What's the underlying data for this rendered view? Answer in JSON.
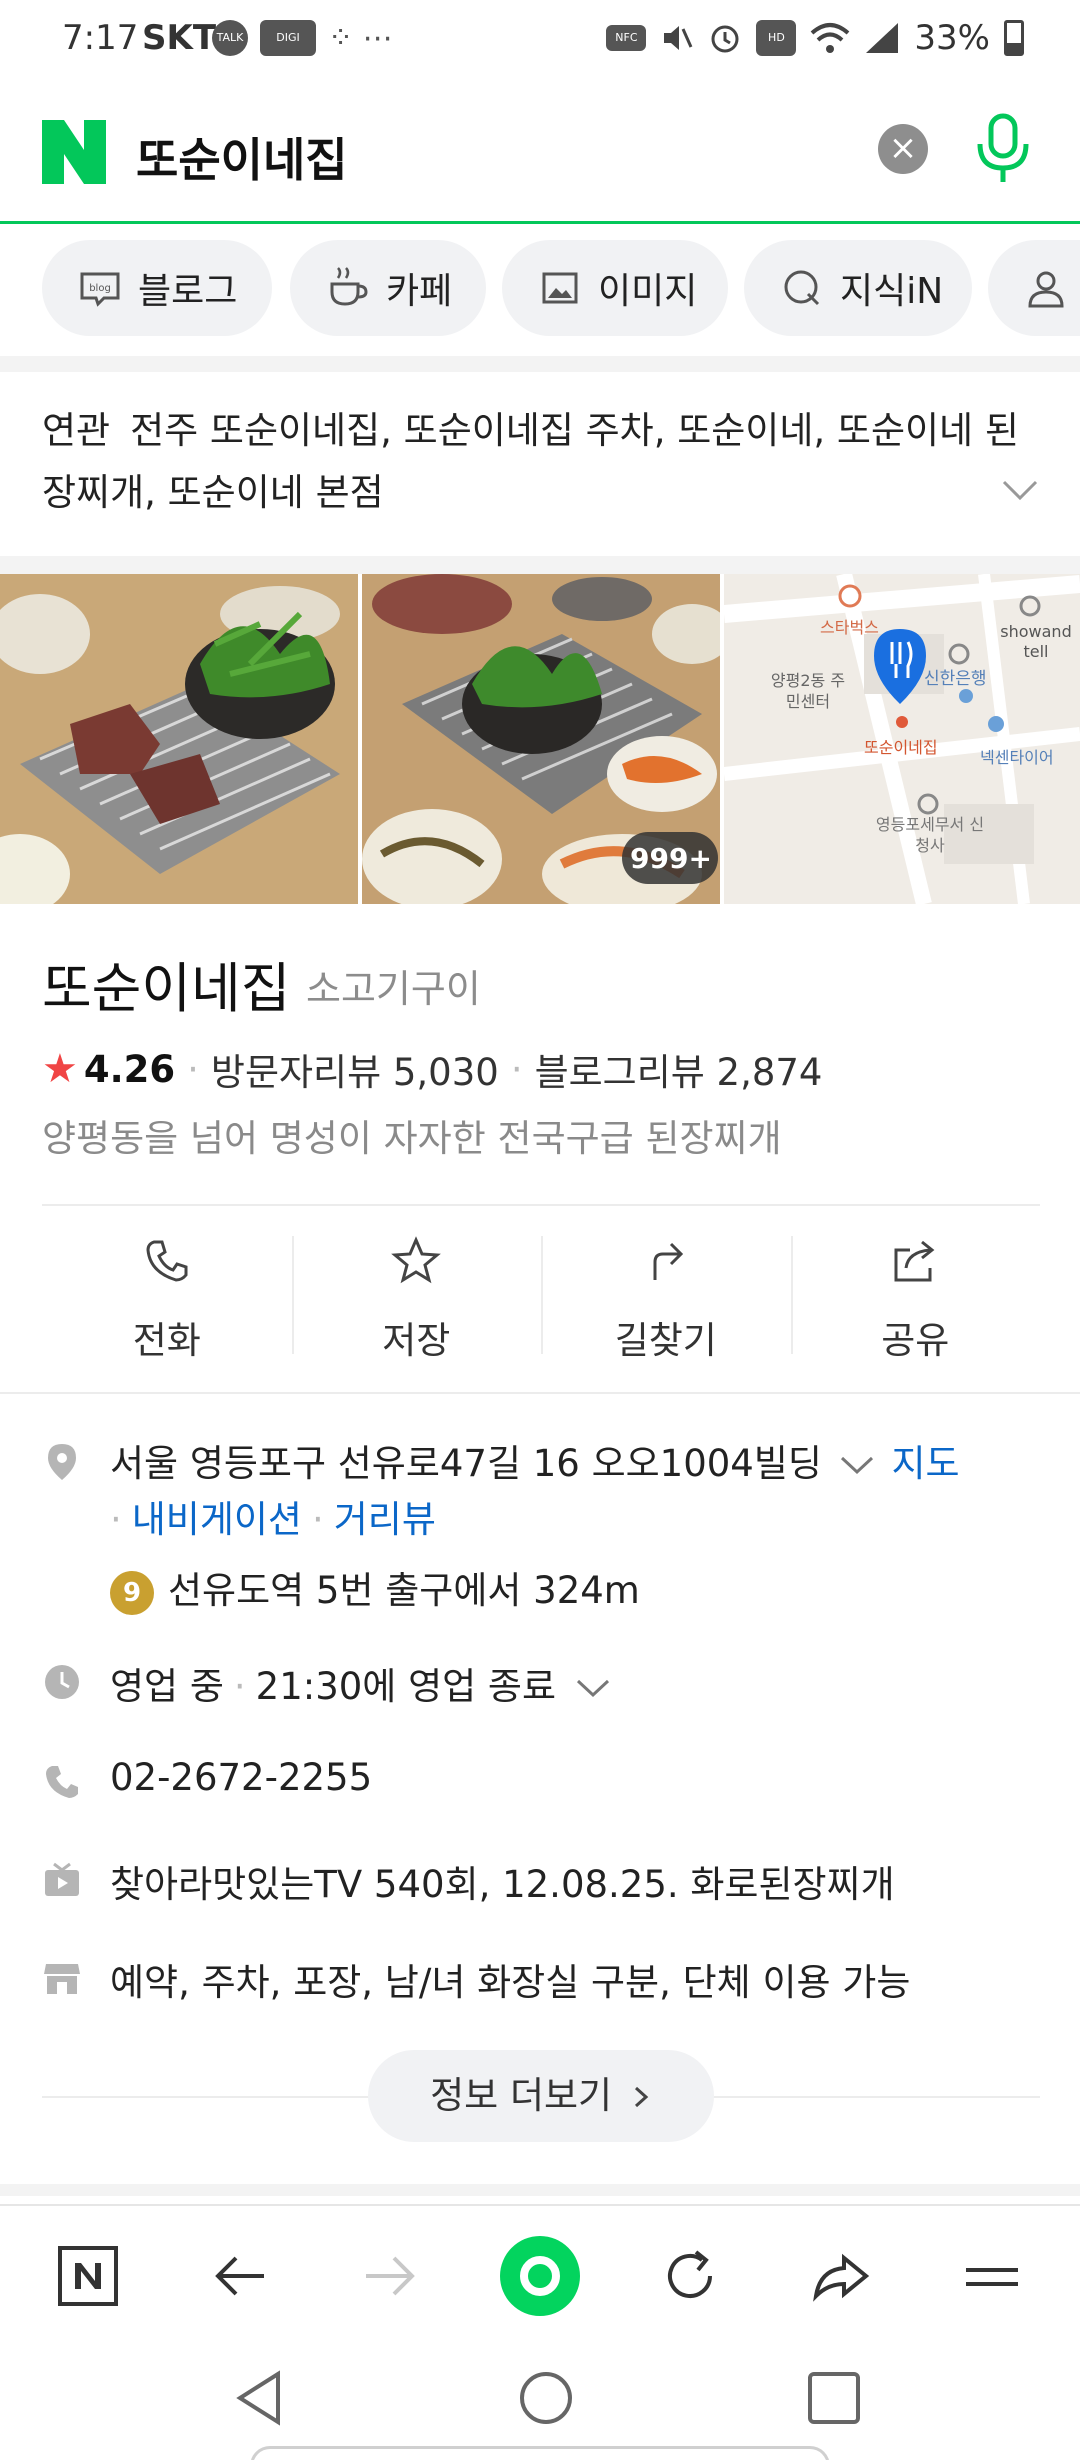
{
  "status_bar": {
    "time": "7:17",
    "carrier": "SKT",
    "battery": "33%",
    "battery_level": 0.33,
    "icons": [
      "talk-icon",
      "digi-loca-icon",
      "nfc-icon",
      "mute-icon",
      "alarm-icon",
      "hd-voice-icon",
      "wifi-icon",
      "signal-icon"
    ]
  },
  "search": {
    "query": "또순이네집",
    "brand_color": "#03c75a"
  },
  "chips": [
    {
      "label": "블로그",
      "icon": "blog-icon"
    },
    {
      "label": "카페",
      "icon": "cafe-cup-icon"
    },
    {
      "label": "이미지",
      "icon": "image-icon"
    },
    {
      "label": "지식iN",
      "icon": "kin-icon"
    },
    {
      "label": "",
      "icon": "person-icon"
    }
  ],
  "related": {
    "label": "연관",
    "text": "전주 또순이네집, 또순이네집 주차, 또순이네, 또순이네 된장찌개, 또순이네 본점"
  },
  "photos": {
    "more_badge": "999+",
    "map_labels": [
      "스타벅스",
      "showand tell",
      "양평2동 주민센터",
      "신한은행",
      "또순이네집",
      "넥센타이어",
      "영등포세무서 신청사"
    ]
  },
  "place": {
    "name": "또순이네집",
    "category": "소고기구이",
    "rating": "4.26",
    "visitor_reviews": "방문자리뷰 5,030",
    "blog_reviews": "블로그리뷰 2,874",
    "description": "양평동을 넘어 명성이 자자한 전국구급 된장찌개"
  },
  "actions": [
    {
      "label": "전화",
      "icon": "phone-icon"
    },
    {
      "label": "저장",
      "icon": "star-icon"
    },
    {
      "label": "길찾기",
      "icon": "directions-icon"
    },
    {
      "label": "공유",
      "icon": "share-icon"
    }
  ],
  "info": {
    "address": "서울 영등포구 선유로47길 16 오오1004빌딩",
    "map_link": "지도",
    "navigation_link": "내비게이션",
    "streetview_link": "거리뷰",
    "subway_line": "9",
    "subway": "선유도역 5번 출구에서 324m",
    "hours_status": "영업 중",
    "hours_detail": "21:30에 영업 종료",
    "phone": "02-2672-2255",
    "tv": "찾아라맛있는TV 540회, 12.08.25. 화로된장찌개",
    "amenities": "예약, 주차, 포장, 남/녀 화장실 구분, 단체 이용 가능",
    "more_button": "정보 더보기"
  },
  "toolbar": {
    "icons": [
      "naver-home-icon",
      "back-arrow-icon",
      "forward-arrow-icon",
      "green-dot-icon",
      "refresh-icon",
      "share-arrow-icon",
      "menu-icon"
    ]
  },
  "android_nav": {
    "icons": [
      "back-triangle-icon",
      "home-circle-icon",
      "recents-square-icon"
    ]
  }
}
